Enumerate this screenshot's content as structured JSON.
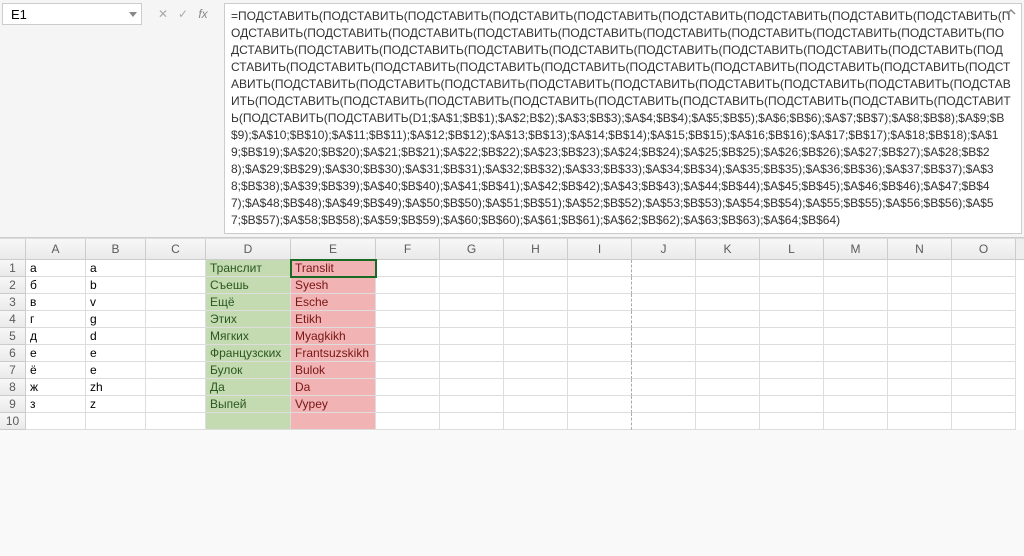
{
  "nameBox": {
    "value": "E1"
  },
  "fx": {
    "cancel": "✕",
    "confirm": "✓",
    "fx": "fx"
  },
  "formula": "=ПОДСТАВИТЬ(ПОДСТАВИТЬ(ПОДСТАВИТЬ(ПОДСТАВИТЬ(ПОДСТАВИТЬ(ПОДСТАВИТЬ(ПОДСТАВИТЬ(ПОДСТАВИТЬ(ПОДСТАВИТЬ(ПОДСТАВИТЬ(ПОДСТАВИТЬ(ПОДСТАВИТЬ(ПОДСТАВИТЬ(ПОДСТАВИТЬ(ПОДСТАВИТЬ(ПОДСТАВИТЬ(ПОДСТАВИТЬ(ПОДСТАВИТЬ(ПОДСТАВИТЬ(ПОДСТАВИТЬ(ПОДСТАВИТЬ(ПОДСТАВИТЬ(ПОДСТАВИТЬ(ПОДСТАВИТЬ(ПОДСТАВИТЬ(ПОДСТАВИТЬ(ПОДСТАВИТЬ(ПОДСТАВИТЬ(ПОДСТАВИТЬ(ПОДСТАВИТЬ(ПОДСТАВИТЬ(ПОДСТАВИТЬ(ПОДСТАВИТЬ(ПОДСТАВИТЬ(ПОДСТАВИТЬ(ПОДСТАВИТЬ(ПОДСТАВИТЬ(ПОДСТАВИТЬ(ПОДСТАВИТЬ(ПОДСТАВИТЬ(ПОДСТАВИТЬ(ПОДСТАВИТЬ(ПОДСТАВИТЬ(ПОДСТАВИТЬ(ПОДСТАВИТЬ(ПОДСТАВИТЬ(ПОДСТАВИТЬ(ПОДСТАВИТЬ(ПОДСТАВИТЬ(ПОДСТАВИТЬ(ПОДСТАВИТЬ(ПОДСТАВИТЬ(ПОДСТАВИТЬ(ПОДСТАВИТЬ(ПОДСТАВИТЬ(ПОДСТАВИТЬ(ПОДСТАВИТЬ(D1;$A$1;$B$1);$A$2;B$2);$A$3;$B$3);$A$4;$B$4);$A$5;$B$5);$A$6;$B$6);$A$7;$B$7);$A$8;$B$8);$A$9;$B$9);$A$10;$B$10);$A$11;$B$11);$A$12;$B$12);$A$13;$B$13);$A$14;$B$14);$A$15;$B$15);$A$16;$B$16);$A$17;$B$17);$A$18;$B$18);$A$19;$B$19);$A$20;$B$20);$A$21;$B$21);$A$22;$B$22);$A$23;$B$23);$A$24;$B$24);$A$25;$B$25);$A$26;$B$26);$A$27;$B$27);$A$28;$B$28);$A$29;$B$29);$A$30;$B$30);$A$31;$B$31);$A$32;$B$32);$A$33;$B$33);$A$34;$B$34);$A$35;$B$35);$A$36;$B$36);$A$37;$B$37);$A$38;$B$38);$A$39;$B$39);$A$40;$B$40);$A$41;$B$41);$A$42;$B$42);$A$43;$B$43);$A$44;$B$44);$A$45;$B$45);$A$46;$B$46);$A$47;$B$47);$A$48;$B$48);$A$49;$B$49);$A$50;$B$50);$A$51;$B$51);$A$52;$B$52);$A$53;$B$53);$A$54;$B$54);$A$55;$B$55);$A$56;$B$56);$A$57;$B$57);$A$58;$B$58);$A$59;$B$59);$A$60;$B$60);$A$61;$B$61);$A$62;$B$62);$A$63;$B$63);$A$64;$B$64)",
  "columns": [
    "A",
    "B",
    "C",
    "D",
    "E",
    "F",
    "G",
    "H",
    "I",
    "J",
    "K",
    "L",
    "M",
    "N",
    "O"
  ],
  "rows": [
    {
      "n": "1",
      "A": "а",
      "B": "a",
      "D": "Транслит",
      "E": "Translit"
    },
    {
      "n": "2",
      "A": "б",
      "B": "b",
      "D": "Съешь",
      "E": "Syesh"
    },
    {
      "n": "3",
      "A": "в",
      "B": "v",
      "D": "Ещё",
      "E": "Esche"
    },
    {
      "n": "4",
      "A": "г",
      "B": "g",
      "D": "Этих",
      "E": "Etikh"
    },
    {
      "n": "5",
      "A": "д",
      "B": "d",
      "D": "Мягких",
      "E": "Myagkikh"
    },
    {
      "n": "6",
      "A": "е",
      "B": "e",
      "D": "Французских",
      "E": "Frantsuzskikh"
    },
    {
      "n": "7",
      "A": "ё",
      "B": "e",
      "D": "Булок",
      "E": "Bulok"
    },
    {
      "n": "8",
      "A": "ж",
      "B": "zh",
      "D": "Да",
      "E": "Da"
    },
    {
      "n": "9",
      "A": "з",
      "B": "z",
      "D": "Выпей",
      "E": "Vypey"
    },
    {
      "n": "10",
      "A": "",
      "B": "",
      "D": "",
      "E": ""
    }
  ],
  "selectedCell": "E1"
}
